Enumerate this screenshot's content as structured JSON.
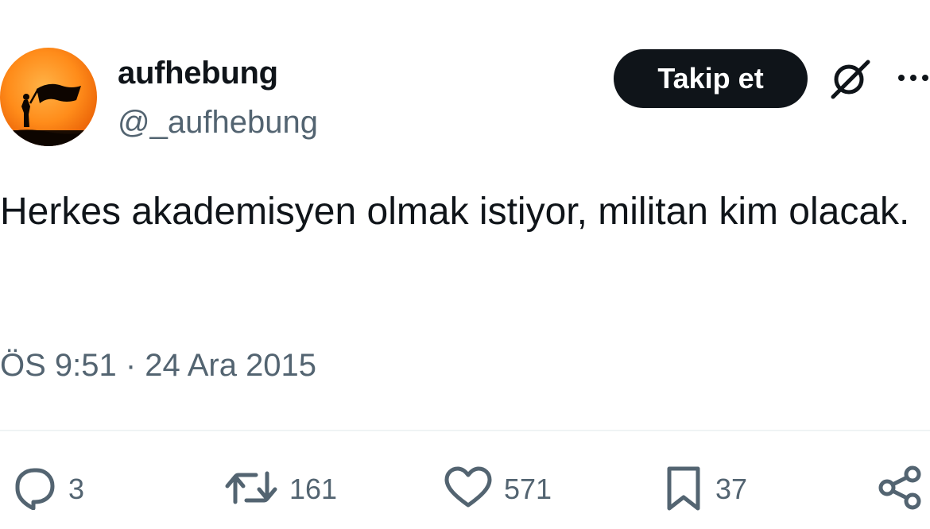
{
  "author": {
    "display_name": "aufhebung",
    "handle": "@_aufhebung",
    "avatar_icon": "avatar-flag-silhouette"
  },
  "header": {
    "follow_label": "Takip et",
    "grok_icon": "grok-icon",
    "more_icon": "more-dots-icon"
  },
  "tweet": {
    "text": "Herkes akademisyen olmak istiyor, militan kim olacak.",
    "timestamp": "ÖS 9:51 · 24 Ara 2015"
  },
  "actions": {
    "reply_count": "3",
    "retweet_count": "161",
    "like_count": "571",
    "bookmark_count": "37"
  },
  "colors": {
    "text_primary": "#0f1419",
    "text_secondary": "#536471",
    "button_bg": "#0f1419",
    "divider": "#eff3f4"
  }
}
